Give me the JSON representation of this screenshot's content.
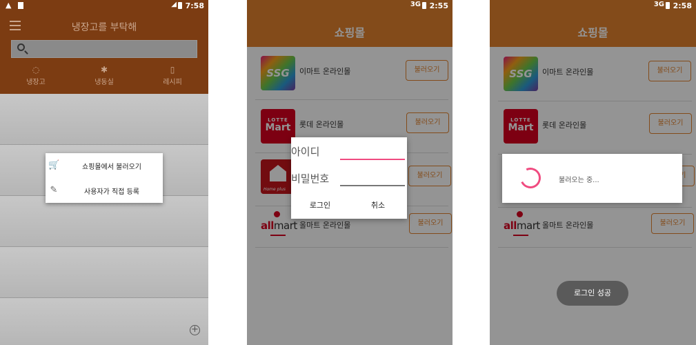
{
  "screen1": {
    "status_time": "7:58",
    "title": "냉장고를 부탁해",
    "tabs": [
      {
        "label": "냉장고",
        "icon": "water-drop-icon"
      },
      {
        "label": "냉동실",
        "icon": "snowflake-icon"
      },
      {
        "label": "레시피",
        "icon": "recipe-icon"
      }
    ],
    "dialog": {
      "items": [
        {
          "label": "쇼핑몰에서 불러오기",
          "icon": "cart-icon"
        },
        {
          "label": "사용자가 직접 등록",
          "icon": "pencil-icon"
        }
      ]
    },
    "fab_symbol": "+"
  },
  "screen2": {
    "status_net": "3G",
    "status_time": "2:55",
    "title": "쇼핑몰",
    "malls": [
      {
        "name": "이마트 온라인몰",
        "button": "불러오기"
      },
      {
        "name": "롯데 온라인몰",
        "button": "불러오기"
      },
      {
        "name": "",
        "button": "불러오기"
      },
      {
        "name": "올마트 온라인몰",
        "button": "불러오기"
      }
    ],
    "login_dialog": {
      "id_label": "아이디",
      "pw_label": "비밀번호",
      "login_button": "로그인",
      "cancel_button": "취소",
      "accent_color": "#f04b80"
    }
  },
  "screen3": {
    "status_net": "3G",
    "status_time": "2:58",
    "title": "쇼핑몰",
    "malls": [
      {
        "name": "이마트 온라인몰",
        "button": "불러오기"
      },
      {
        "name": "롯데 온라인몰",
        "button": "불러오기"
      },
      {
        "name": "",
        "button": "불러오기"
      },
      {
        "name": "올마트 온라인몰",
        "button": "불러오기"
      }
    ],
    "loading_text": "불러오는 중...",
    "toast": "로그인 성공"
  },
  "logos": {
    "ssg": "SSG",
    "lotte_top": "LOTTE",
    "lotte_bottom": "Mart",
    "homeplus": "Home plus",
    "allmart_prefix": "all",
    "allmart_suffix": "mart"
  },
  "colors": {
    "brand_orange": "#e2822e",
    "dim_header": "#7c3c12",
    "spinner": "#f04b80"
  }
}
